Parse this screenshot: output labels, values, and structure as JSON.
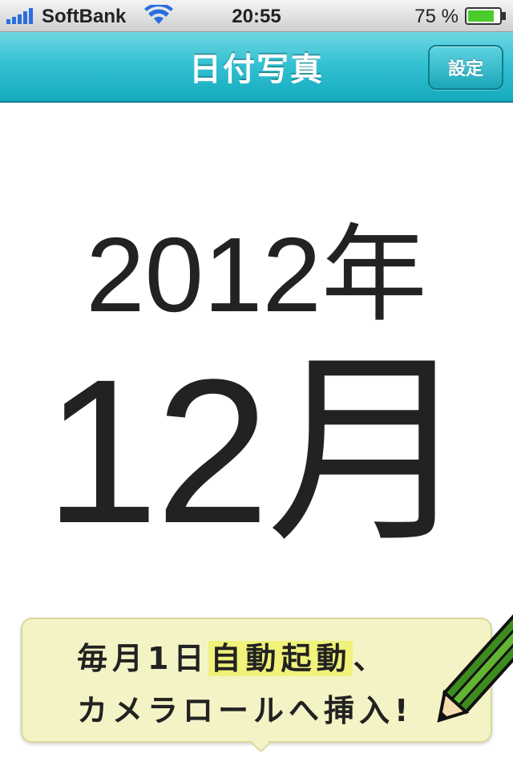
{
  "status_bar": {
    "carrier": "SoftBank",
    "time": "20:55",
    "battery_percent": "75 %",
    "icons": [
      "signal-icon",
      "wifi-icon",
      "battery-icon"
    ]
  },
  "nav": {
    "title": "日付写真",
    "settings_label": "設定"
  },
  "main": {
    "year": "2012年",
    "month": "12月"
  },
  "banner": {
    "line1_prefix": "毎月1日",
    "line1_highlight": "自動起動",
    "line1_suffix": "、",
    "line2": "カメラロールへ挿入!",
    "highlight_color": "#f0f27a",
    "note_color": "#f4f3c5"
  },
  "colors": {
    "accent": "#35c2d3",
    "text": "#222222"
  }
}
